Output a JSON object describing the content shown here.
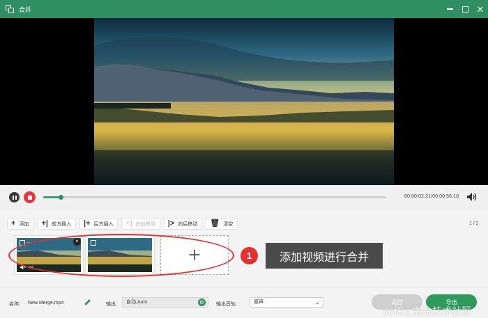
{
  "window": {
    "title": "合并",
    "accent": "#2f8f60"
  },
  "player": {
    "timecode": "00:00:02.21/00:00:56.18",
    "progress_fraction": 0.05
  },
  "toolbar": {
    "add": "添加",
    "insert_before": "前方插入",
    "insert_after": "后方插入",
    "move_forward": "向前移动",
    "move_backward": "向后移动",
    "clear": "清空",
    "page_count": "1 / 2"
  },
  "clips": {
    "first_clip_title": "..."
  },
  "annotation": {
    "step_number": "1",
    "tooltip": "添加视频进行合并",
    "color": "#e53030"
  },
  "bottom": {
    "name_label": "名称:",
    "name_value": "New Merge.mp4",
    "output_label": "输出:",
    "output_value": "自动;Auto",
    "audio_label": "输出音轨:",
    "audio_value": "原声",
    "back_label": "返回",
    "export_label": "导出"
  },
  "watermark": "@稀土掘金技术社区"
}
